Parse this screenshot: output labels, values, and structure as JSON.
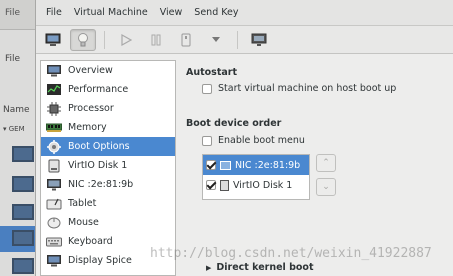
{
  "background_window": {
    "menu_file": "File",
    "menu_file2": "File",
    "column_name": "Name",
    "group_label": "GEM"
  },
  "menubar": {
    "items": [
      "File",
      "Virtual Machine",
      "View",
      "Send Key"
    ]
  },
  "toolbar": {
    "buttons": [
      "console-icon",
      "details-bulb-icon",
      "run-icon",
      "pause-icon",
      "shutdown-icon",
      "dropdown-arrow-icon",
      "fullscreen-icon"
    ],
    "active": "details-bulb-icon"
  },
  "sidebar": {
    "items": [
      {
        "label": "Overview",
        "icon": "monitor-icon"
      },
      {
        "label": "Performance",
        "icon": "performance-icon"
      },
      {
        "label": "Processor",
        "icon": "processor-icon"
      },
      {
        "label": "Memory",
        "icon": "memory-icon"
      },
      {
        "label": "Boot Options",
        "icon": "boot-options-icon"
      },
      {
        "label": "VirtIO Disk 1",
        "icon": "disk-icon"
      },
      {
        "label": "NIC :2e:81:9b",
        "icon": "nic-icon"
      },
      {
        "label": "Tablet",
        "icon": "tablet-icon"
      },
      {
        "label": "Mouse",
        "icon": "mouse-icon"
      },
      {
        "label": "Keyboard",
        "icon": "keyboard-icon"
      },
      {
        "label": "Display Spice",
        "icon": "display-icon"
      }
    ],
    "selected_index": 4
  },
  "autostart": {
    "title": "Autostart",
    "option_label": "Start virtual machine on host boot up",
    "checked": false
  },
  "boot_order": {
    "title": "Boot device order",
    "enable_menu_label": "Enable boot menu",
    "enable_menu_checked": false,
    "devices": [
      {
        "label": "NIC :2e:81:9b",
        "checked": true,
        "selected": true
      },
      {
        "label": "VirtIO Disk 1",
        "checked": true,
        "selected": false
      }
    ]
  },
  "direct_kernel_boot": {
    "label": "Direct kernel boot"
  },
  "watermark": "http://blog.csdn.net/weixin_41922887",
  "colors": {
    "selection": "#4a88d0",
    "window_bg": "#ededec"
  }
}
